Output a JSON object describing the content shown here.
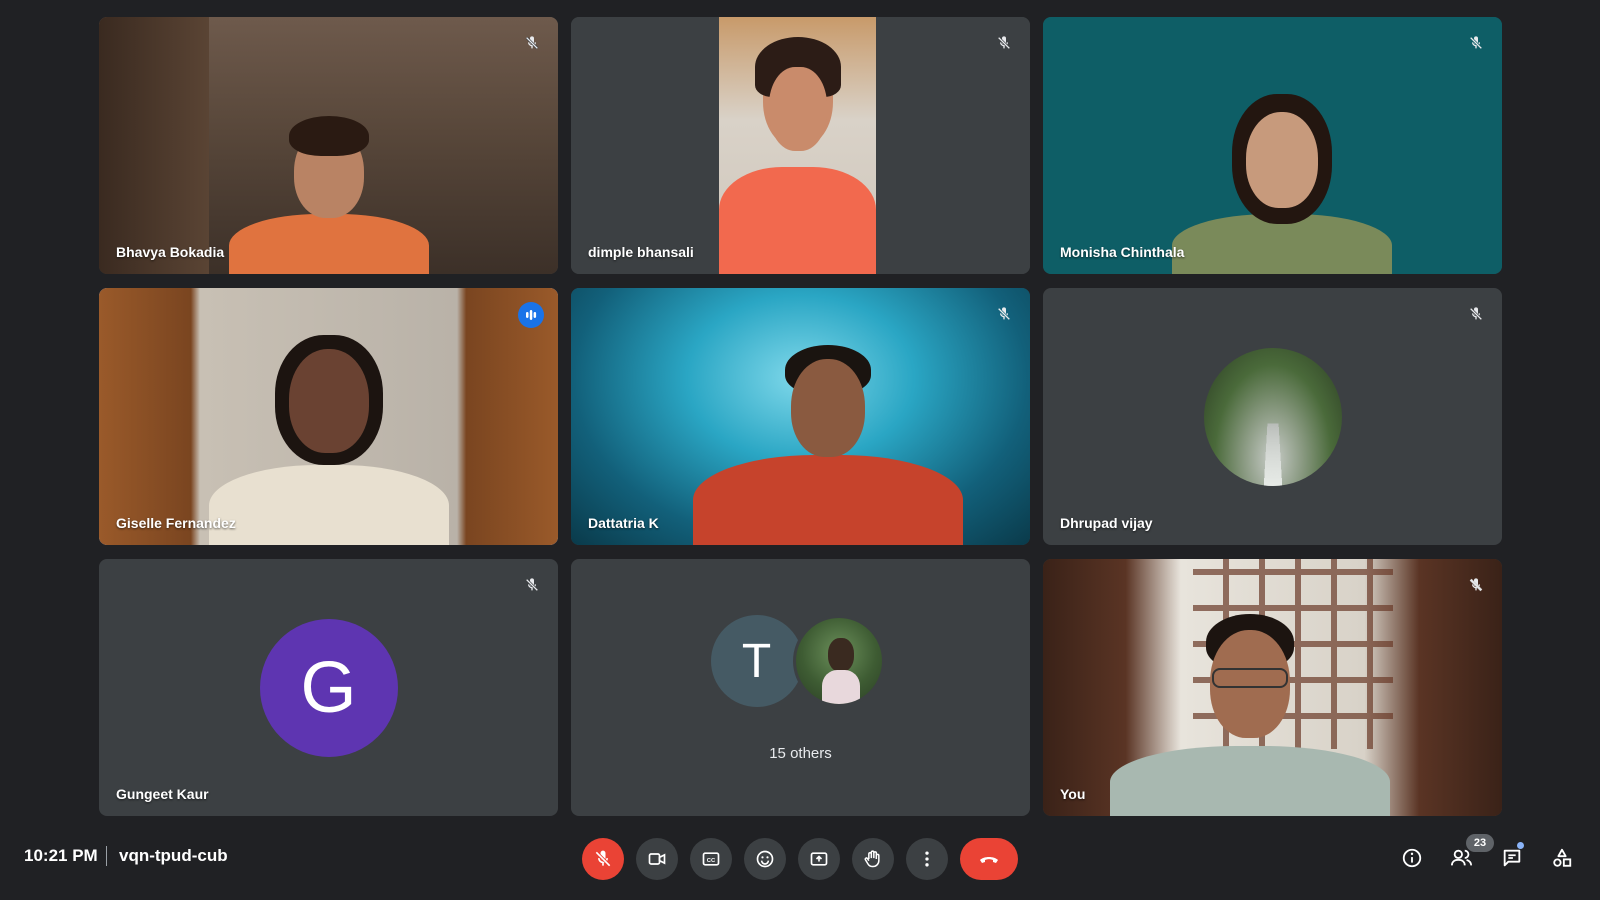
{
  "participants": [
    {
      "name": "Bhavya Bokadia",
      "muted": true
    },
    {
      "name": "dimple bhansali",
      "muted": true
    },
    {
      "name": "Monisha Chinthala",
      "muted": true
    },
    {
      "name": "Giselle Fernandez",
      "muted": false,
      "speaking": true
    },
    {
      "name": "Dattatria K",
      "muted": true
    },
    {
      "name": "Dhrupad vijay",
      "muted": true
    },
    {
      "name": "Gungeet Kaur",
      "muted": true,
      "avatar_letter": "G",
      "avatar_color": "#5e35b1"
    },
    {
      "others_letter": "T",
      "others_label": "15 others"
    },
    {
      "name": "You",
      "muted": true
    }
  ],
  "meeting": {
    "time": "10:21 PM",
    "code": "vqn-tpud-cub"
  },
  "controls": {
    "mic": "mic-off-icon",
    "camera": "camera-icon",
    "captions": "captions-icon",
    "reactions": "emoji-icon",
    "present": "present-screen-icon",
    "raise_hand": "raise-hand-icon",
    "more": "more-options-icon",
    "leave": "leave-call-icon"
  },
  "right_controls": {
    "people_count": "23"
  },
  "colors": {
    "speaking_outline": "#8ab4f8",
    "end_call": "#ea4335",
    "tile_bg": "#3c4043",
    "page_bg": "#202124"
  }
}
